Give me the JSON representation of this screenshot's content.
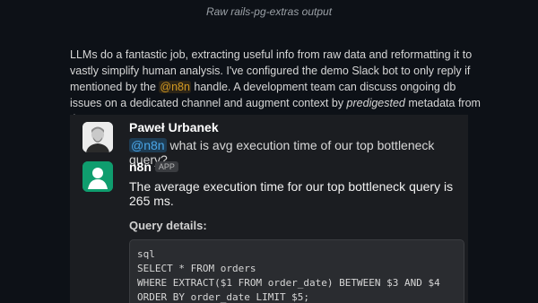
{
  "caption": "Raw rails-pg-extras output",
  "article": {
    "part1": "LLMs do a fantastic job, extracting useful info from raw data and reformatting it to vastly simplify human analysis. I've configured the demo Slack bot to only reply if mentioned by the ",
    "handle": "@n8n",
    "part2": " handle. A development team can discuss ongoing db issues on a dedicated channel and augment context by ",
    "em": "predigested",
    "part3": " metadata from the LLM."
  },
  "thread": {
    "user": {
      "name": "Paweł Urbanek",
      "mention": "@n8n",
      "message": " what is avg execution time of our top bottleneck query?"
    },
    "bot": {
      "name": "n8n",
      "tag": "APP",
      "answer": "The average execution time for our top bottleneck query is 265 ms.",
      "details_label": "Query details:",
      "code_lines": [
        "sql",
        "SELECT * FROM orders",
        "WHERE EXTRACT($1 FROM order_date) BETWEEN $3 AND $4",
        "ORDER BY order_date LIMIT $5;"
      ]
    }
  }
}
